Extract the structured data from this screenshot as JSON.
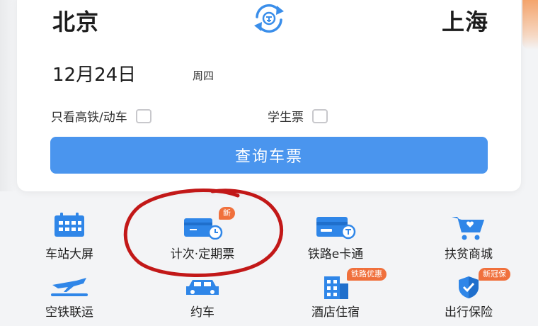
{
  "search": {
    "from_city": "北京",
    "to_city": "上海",
    "date": "12月24日",
    "weekday": "周四",
    "option_highspeed": "只看高铁/动车",
    "option_student": "学生票",
    "query_button": "查询车票"
  },
  "services": {
    "row1": [
      {
        "label": "车站大屏",
        "icon": "station-screen-icon"
      },
      {
        "label": "计次·定期票",
        "icon": "ticket-card-icon",
        "badge": "新"
      },
      {
        "label": "铁路e卡通",
        "icon": "rail-ecard-icon"
      },
      {
        "label": "扶贫商城",
        "icon": "shopping-cart-icon"
      }
    ],
    "row2": [
      {
        "label": "空铁联运",
        "icon": "plane-rail-icon"
      },
      {
        "label": "约车",
        "icon": "car-icon"
      },
      {
        "label": "酒店住宿",
        "icon": "hotel-icon",
        "badge": "铁路优惠"
      },
      {
        "label": "出行保险",
        "icon": "insurance-shield-icon",
        "badge": "新冠保"
      }
    ]
  },
  "colors": {
    "primary_blue": "#4a95ee",
    "icon_blue": "#2f86e8",
    "badge_orange": "#f0703c",
    "annotation_red": "#c21818"
  }
}
